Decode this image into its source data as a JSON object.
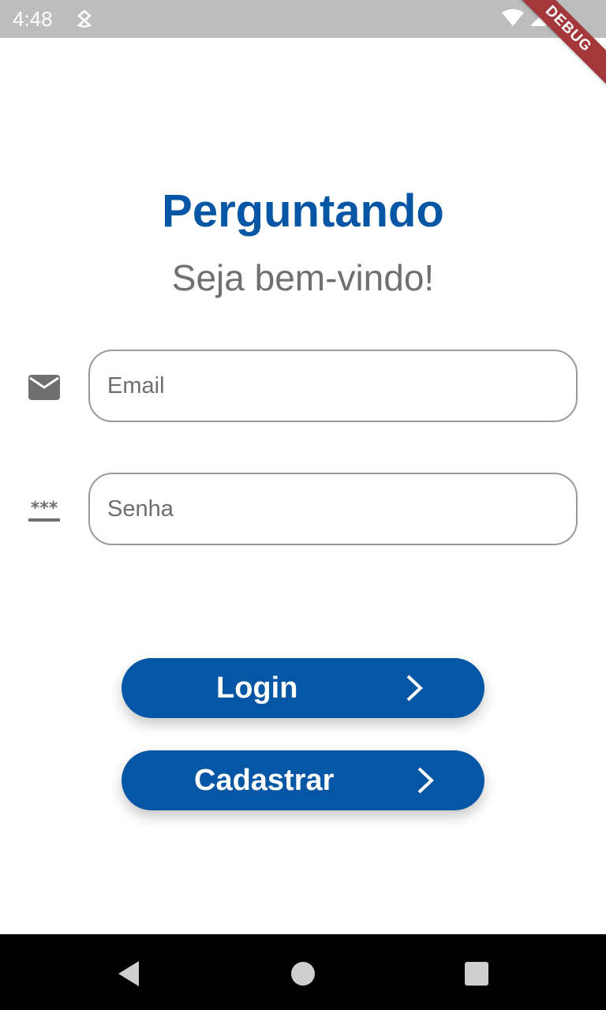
{
  "status_bar": {
    "time": "4:48",
    "icons": [
      "notification-icon",
      "wifi-icon",
      "signal-icon",
      "battery-icon"
    ]
  },
  "debug_banner": "DEBUG",
  "header": {
    "title": "Perguntando",
    "subtitle": "Seja bem-vindo!"
  },
  "form": {
    "email": {
      "placeholder": "Email",
      "value": "",
      "icon": "mail-icon"
    },
    "password": {
      "placeholder": "Senha",
      "value": "",
      "icon": "password-icon"
    }
  },
  "buttons": {
    "login": {
      "label": "Login",
      "icon": "chevron-right-icon"
    },
    "register": {
      "label": "Cadastrar",
      "icon": "chevron-right-icon"
    }
  },
  "nav_bar": {
    "items": [
      "back-icon",
      "home-icon",
      "recents-icon"
    ]
  },
  "colors": {
    "primary": "#0656a6",
    "subtitle": "#707070",
    "status_bar": "#bdbdbd",
    "debug_banner": "#a4373a",
    "field_border": "#9a9a9a"
  }
}
